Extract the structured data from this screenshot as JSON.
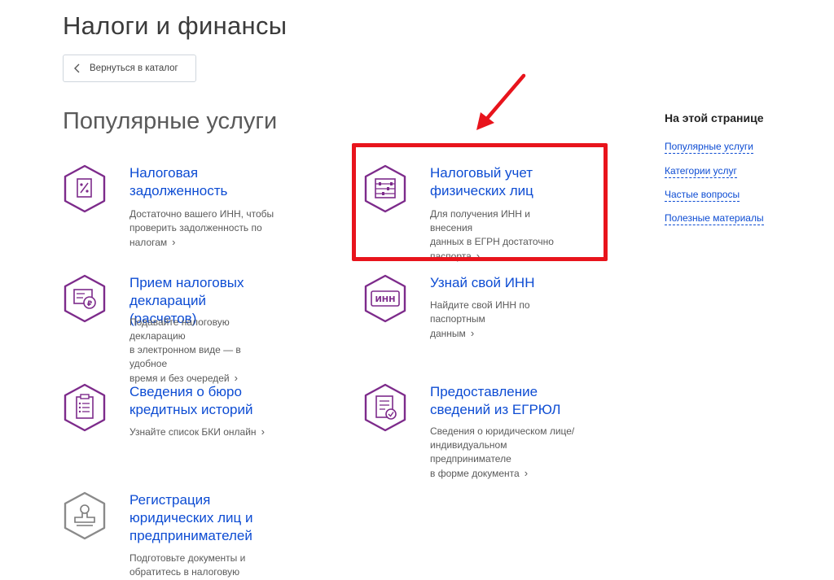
{
  "page": {
    "title": "Налоги и финансы"
  },
  "back_button": {
    "label": "Вернуться в каталог"
  },
  "section": {
    "title": "Популярные услуги"
  },
  "services": [
    {
      "title_lines": [
        "Налоговая",
        "задолженность"
      ],
      "desc_lines": [
        "Достаточно вашего ИНН, чтобы",
        "проверить задолженность по",
        "налогам"
      ],
      "icon": "percent-document-icon"
    },
    {
      "title_lines": [
        "Налоговый учет",
        "физических лиц"
      ],
      "desc_lines": [
        "Для получения ИНН и внесения",
        "данных в ЕГРН достаточно",
        "паспорта"
      ],
      "icon": "abacus-icon"
    },
    {
      "title_lines": [
        "Прием налоговых",
        "деклараций (расчетов)"
      ],
      "desc_lines": [
        "Подавайте налоговую декларацию",
        "в электронном виде — в удобное",
        "время и без очередей"
      ],
      "icon": "ruble-document-icon"
    },
    {
      "title_lines": [
        "Узнай свой ИНН"
      ],
      "desc_lines": [
        "Найдите свой ИНН по паспортным",
        "данным"
      ],
      "icon": "inn-card-icon",
      "icon_text": "ИНН"
    },
    {
      "title_lines": [
        "Сведения о бюро",
        "кредитных историй"
      ],
      "desc_lines": [
        "Узнайте список БКИ онлайн"
      ],
      "icon": "clipboard-list-icon"
    },
    {
      "title_lines": [
        "Предоставление",
        "сведений из ЕГРЮЛ"
      ],
      "desc_lines": [
        "Сведения о юридическом лице/",
        "индивидуальном предпринимателе",
        "в форме документа"
      ],
      "icon": "certified-document-icon"
    },
    {
      "title_lines": [
        "Регистрация",
        "юридических лиц и",
        "предпринимателей"
      ],
      "desc_lines": [
        "Подготовьте документы и",
        "обратитесь в налоговую инспекцию"
      ],
      "icon": "stamp-icon"
    }
  ],
  "sidebar": {
    "title": "На этой странице",
    "links": [
      "Популярные услуги",
      "Категории услуг",
      "Частые вопросы",
      "Полезные материалы"
    ]
  },
  "colors": {
    "accent": "#0d4cd3",
    "icon_purple": "#7d2b8b",
    "highlight_red": "#e8141c"
  }
}
